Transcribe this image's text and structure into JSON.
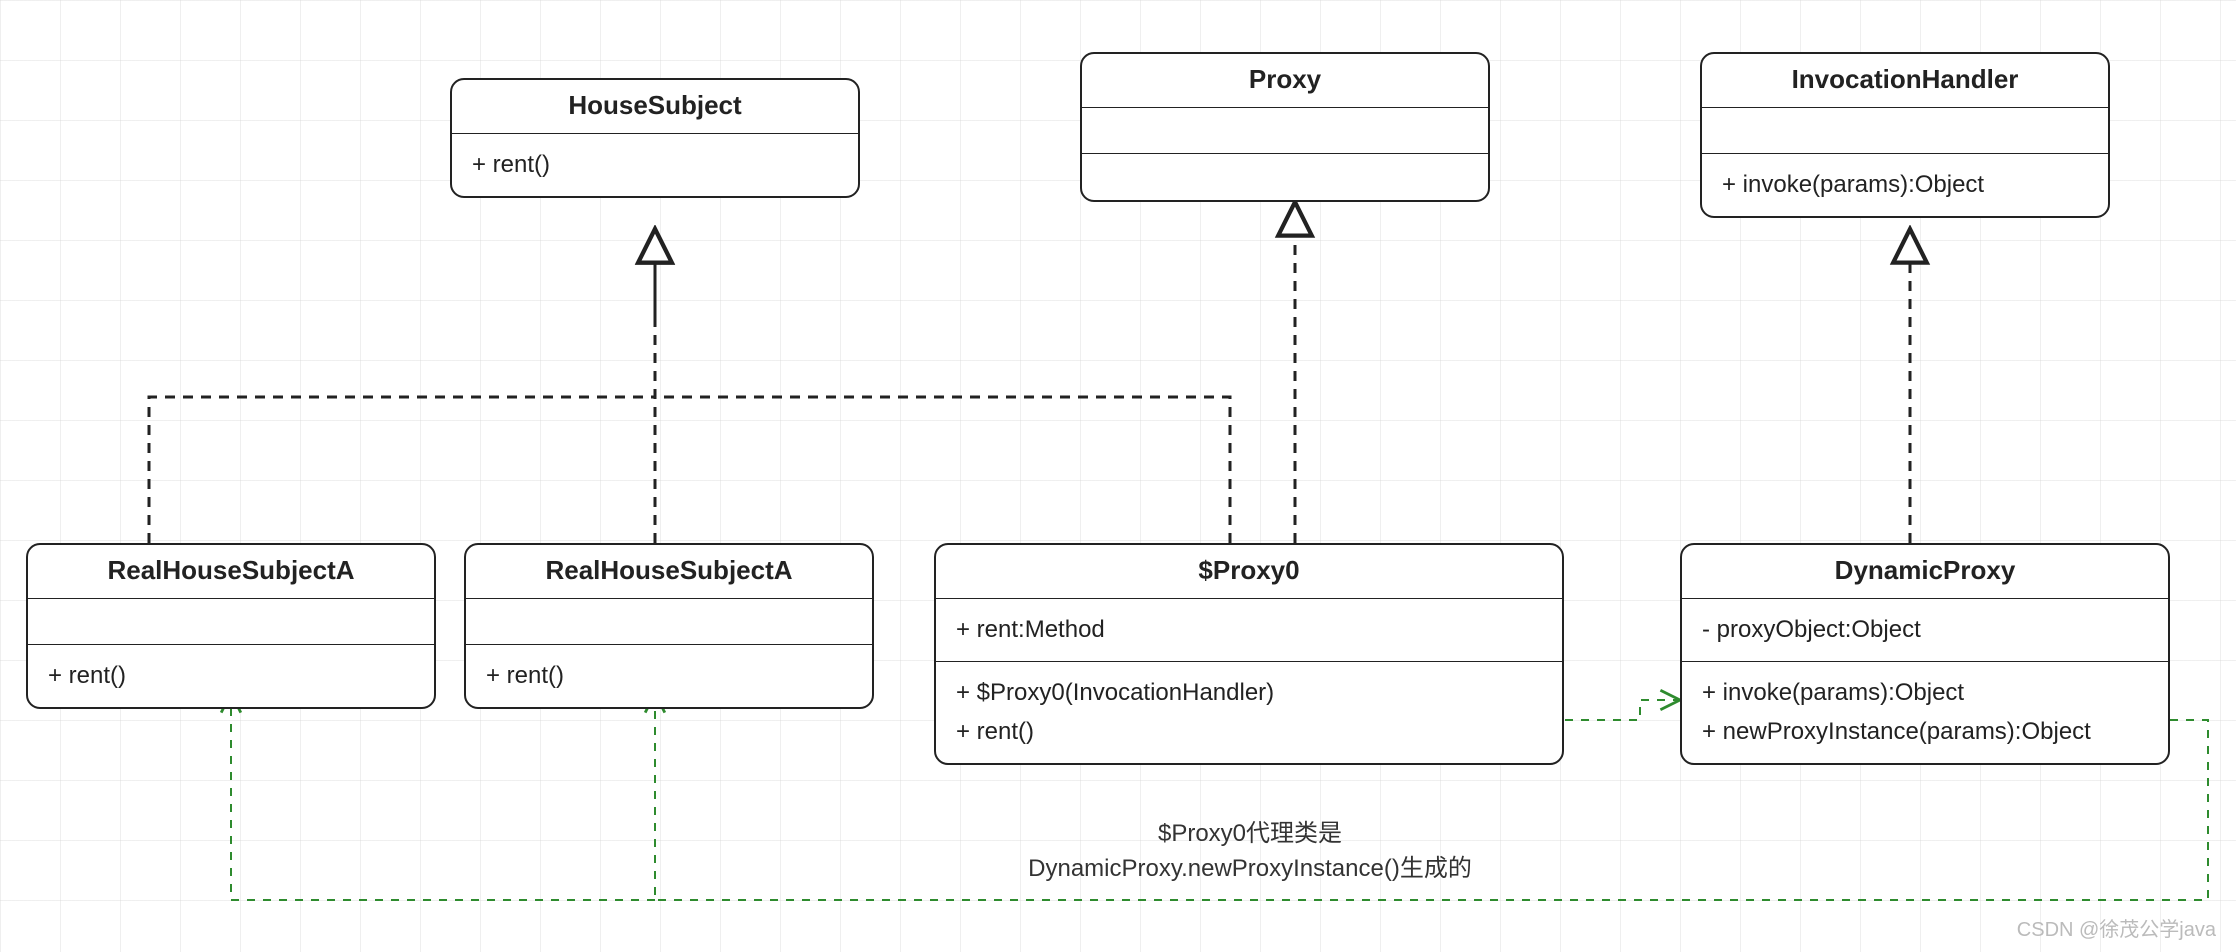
{
  "classes": {
    "houseSubject": {
      "name": "HouseSubject",
      "methods": [
        "+ rent()"
      ]
    },
    "proxy": {
      "name": "Proxy",
      "members": []
    },
    "invocationHandler": {
      "name": "InvocationHandler",
      "methods": [
        "+ invoke(params):Object"
      ]
    },
    "realA1": {
      "name": "RealHouseSubjectA",
      "methods": [
        "+ rent()"
      ]
    },
    "realA2": {
      "name": "RealHouseSubjectA",
      "methods": [
        "+ rent()"
      ]
    },
    "proxy0": {
      "name": "$Proxy0",
      "fields": [
        "+ rent:Method"
      ],
      "methods": [
        "+ $Proxy0(InvocationHandler)",
        "+ rent()"
      ]
    },
    "dynamicProxy": {
      "name": "DynamicProxy",
      "fields": [
        "- proxyObject:Object"
      ],
      "methods": [
        "+ invoke(params):Object",
        "+ newProxyInstance(params):Object"
      ]
    }
  },
  "note": {
    "line1": "$Proxy0代理类是",
    "line2": "DynamicProxy.newProxyInstance()生成的"
  },
  "watermark": "CSDN @徐茂公学java"
}
